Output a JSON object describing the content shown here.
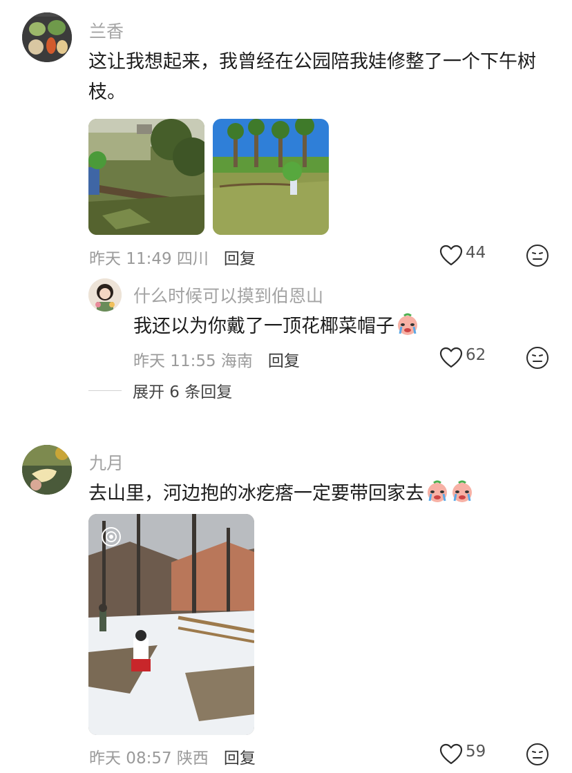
{
  "comments": [
    {
      "author": "兰香",
      "text": "这让我想起来，我曾经在公园陪我娃修整了一个下午树枝。",
      "meta": "昨天 11:49 四川",
      "reply_label": "回复",
      "likes": "44",
      "reply": {
        "author": "什么时候可以摸到伯恩山",
        "text": "我还以为你戴了一顶花椰菜帽子",
        "meta": "昨天 11:55 海南",
        "reply_label": "回复",
        "likes": "62"
      },
      "expand_label": "展开 6 条回复"
    },
    {
      "author": "九月",
      "text": "去山里，河边抱的冰疙瘩一定要带回家去",
      "meta": "昨天 08:57 陕西",
      "reply_label": "回复",
      "likes": "59"
    }
  ],
  "icons": {
    "like": "heart-outline-icon",
    "react": "neutral-face-icon",
    "live_photo": "live-photo-icon",
    "inline_emoji": "crying-face-emoji"
  },
  "colors": {
    "meta_gray": "#9a9a9a",
    "name_gray": "#a3a3a3"
  }
}
